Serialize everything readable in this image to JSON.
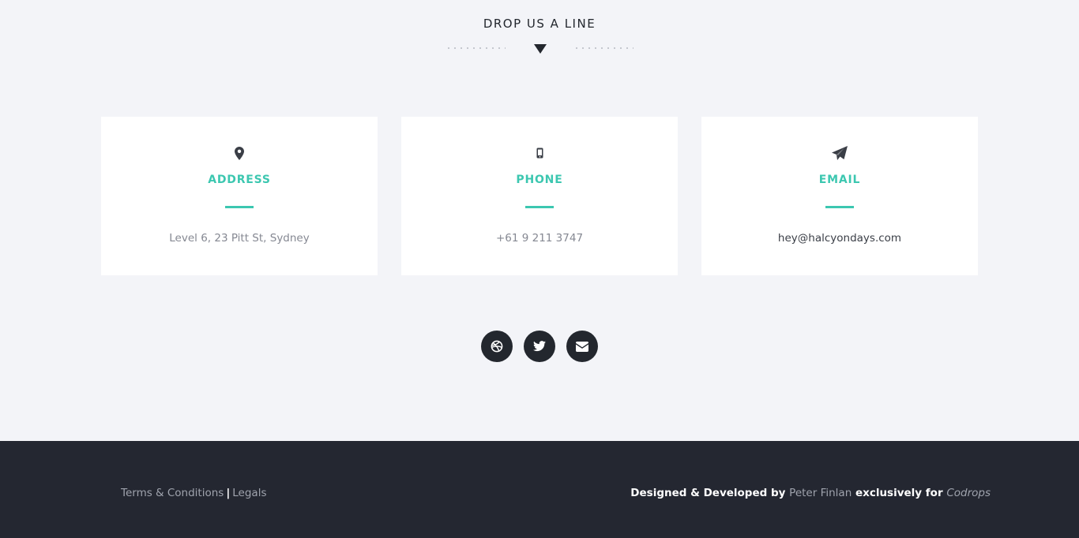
{
  "section": {
    "heading": "DROP US A LINE"
  },
  "cards": [
    {
      "title": "ADDRESS",
      "text": "Level 6, 23 Pitt St, Sydney",
      "icon": "map-pin-icon"
    },
    {
      "title": "PHONE",
      "text": "+61 9 211 3747",
      "icon": "mobile-phone-icon"
    },
    {
      "title": "EMAIL",
      "text": "hey@halcyondays.com",
      "icon": "paper-plane-icon"
    }
  ],
  "social": [
    {
      "name": "dribbble",
      "icon": "dribbble-icon"
    },
    {
      "name": "twitter",
      "icon": "twitter-icon"
    },
    {
      "name": "email",
      "icon": "envelope-icon"
    }
  ],
  "footer": {
    "terms": "Terms & Conditions",
    "separator": "|",
    "legals": "Legals",
    "credit_prefix": "Designed & Developed by",
    "author": "Peter Finlan",
    "credit_middle": "exclusively for",
    "publisher": "Codrops"
  },
  "colors": {
    "accent": "#3cc7b0",
    "dark": "#23272e",
    "background": "#f3f4f8",
    "footer": "#242731"
  }
}
